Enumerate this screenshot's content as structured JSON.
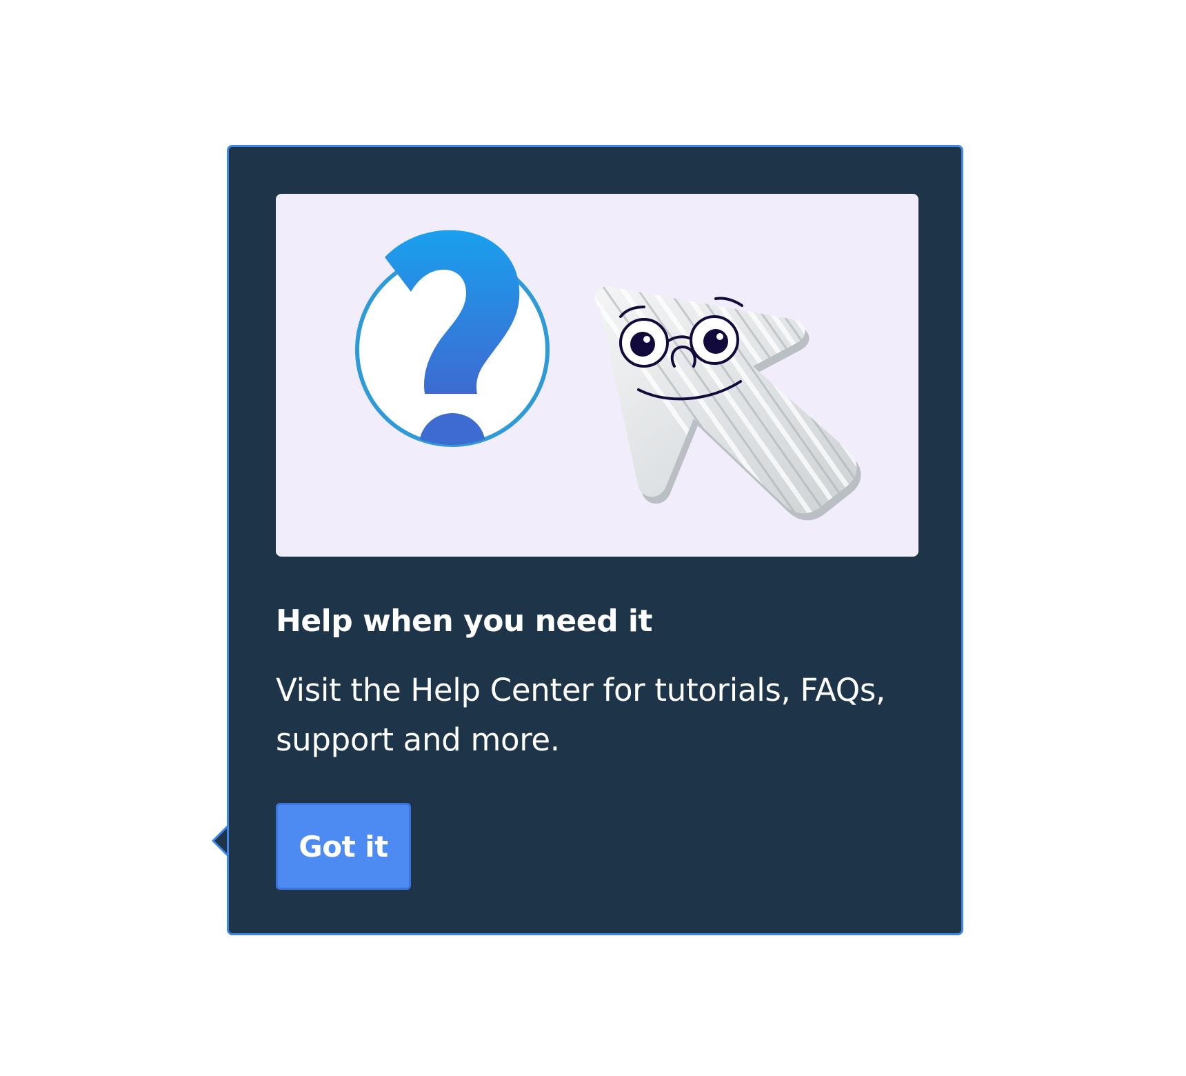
{
  "popover": {
    "illustration": {
      "left": "question-mark-circle-icon",
      "right": "smiling-cursor-mascot"
    },
    "title": "Help when you need it",
    "body": "Visit the Help Center for tutorials, FAQs, support and more.",
    "button_label": "Got it"
  },
  "colors": {
    "panel_background": "#1e3448",
    "panel_border": "#3f86e6",
    "illustration_background": "#f2edfb",
    "button_background": "#4d8bf2",
    "text": "#ffffff"
  }
}
